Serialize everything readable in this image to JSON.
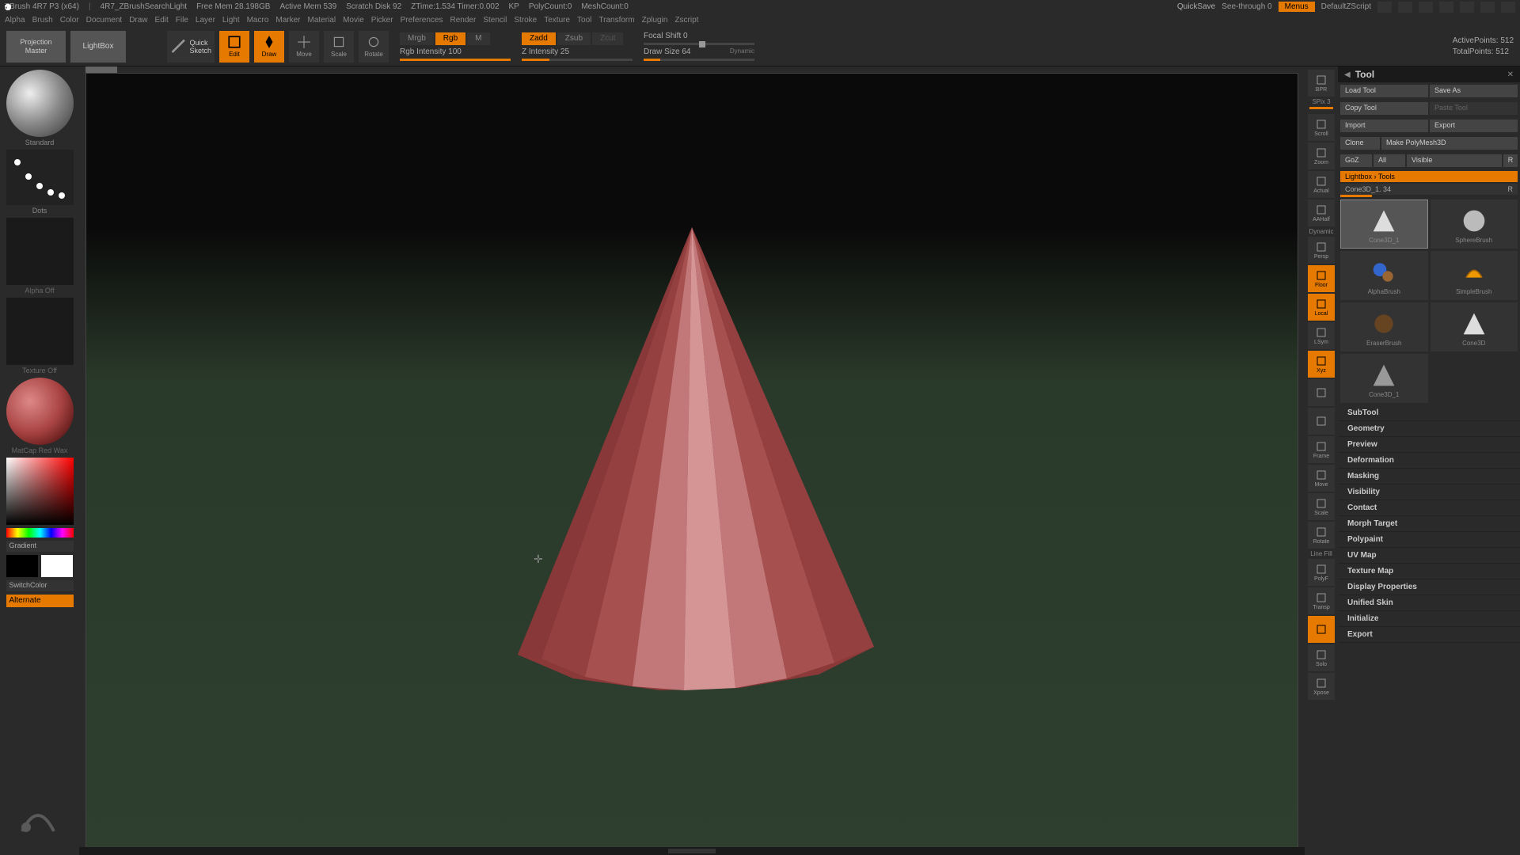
{
  "titlebar": {
    "app": "ZBrush 4R7 P3 (x64)",
    "doc": "4R7_ZBrushSearchLight",
    "freemem": "Free Mem 28.198GB",
    "activemem": "Active Mem 539",
    "scratch": "Scratch Disk 92",
    "ztime": "ZTime:1.534 Timer:0.002",
    "kp": "KP",
    "polycount": "PolyCount:0",
    "meshcount": "MeshCount:0",
    "quicksave": "QuickSave",
    "seethrough": "See-through  0",
    "menus": "Menus",
    "script": "DefaultZScript"
  },
  "menubar": [
    "Alpha",
    "Brush",
    "Color",
    "Document",
    "Draw",
    "Edit",
    "File",
    "Layer",
    "Light",
    "Macro",
    "Marker",
    "Material",
    "Movie",
    "Picker",
    "Preferences",
    "Render",
    "Stencil",
    "Stroke",
    "Texture",
    "Tool",
    "Transform",
    "Zplugin",
    "Zscript"
  ],
  "toptool": {
    "projection": "Projection\nMaster",
    "lightbox": "LightBox",
    "quicksketch": "Quick\nSketch",
    "edit": "Edit",
    "draw": "Draw",
    "move": "Move",
    "scale": "Scale",
    "rotate": "Rotate",
    "mrgb": "Mrgb",
    "rgb": "Rgb",
    "m": "M",
    "rgb_intensity": "Rgb Intensity 100",
    "zadd": "Zadd",
    "zsub": "Zsub",
    "zcut": "Zcut",
    "z_intensity": "Z Intensity 25",
    "focal": "Focal Shift 0",
    "drawsize": "Draw Size 64",
    "dynamic": "Dynamic",
    "active_pts": "ActivePoints: 512",
    "total_pts": "TotalPoints: 512"
  },
  "leftpanel": {
    "brush": "Standard",
    "stroke": "Dots",
    "alpha": "Alpha Off",
    "texture": "Texture Off",
    "material": "MatCap Red Wax",
    "gradient": "Gradient",
    "switchcolor": "SwitchColor",
    "alternate": "Alternate"
  },
  "righticons": [
    {
      "label": "BPR",
      "active": false
    },
    {
      "label": "SPix 3",
      "active": false,
      "text": true
    },
    {
      "label": "Scroll",
      "active": false
    },
    {
      "label": "Zoom",
      "active": false
    },
    {
      "label": "Actual",
      "active": false
    },
    {
      "label": "AAHalf",
      "active": false
    },
    {
      "label": "Persp",
      "active": false,
      "pre": "Dynamic"
    },
    {
      "label": "Floor",
      "active": true
    },
    {
      "label": "Local",
      "active": true
    },
    {
      "label": "LSym",
      "active": false
    },
    {
      "label": "Xyz",
      "active": true
    },
    {
      "label": "",
      "active": false
    },
    {
      "label": "",
      "active": false
    },
    {
      "label": "Frame",
      "active": false
    },
    {
      "label": "Move",
      "active": false
    },
    {
      "label": "Scale",
      "active": false
    },
    {
      "label": "Rotate",
      "active": false
    },
    {
      "label": "PolyF",
      "active": false,
      "pre": "Line Fill"
    },
    {
      "label": "Transp",
      "active": false
    },
    {
      "label": "",
      "active": true
    },
    {
      "label": "Solo",
      "active": false
    },
    {
      "label": "Xpose",
      "active": false
    }
  ],
  "toolpanel": {
    "title": "Tool",
    "row1": [
      "Load Tool",
      "Save As"
    ],
    "row2": [
      "Copy Tool",
      "Paste Tool"
    ],
    "row3": [
      "Import",
      "Export"
    ],
    "row4": [
      "Clone",
      "Make PolyMesh3D"
    ],
    "row5": [
      "GoZ",
      "All",
      "Visible",
      "R"
    ],
    "lightbox_hdr": "Lightbox › Tools",
    "toolname": "Cone3D_1. 34",
    "r": "R",
    "thumbs": [
      "Cone3D_1",
      "SphereBrush",
      "AlphaBrush",
      "SimpleBrush",
      "EraserBrush",
      "Cone3D",
      "Cone3D_1"
    ],
    "accordion": [
      "SubTool",
      "Geometry",
      "Preview",
      "Deformation",
      "Masking",
      "Visibility",
      "Contact",
      "Morph Target",
      "Polypaint",
      "UV Map",
      "Texture Map",
      "Display Properties",
      "Unified Skin",
      "Initialize",
      "Export"
    ]
  },
  "chart_data": null
}
